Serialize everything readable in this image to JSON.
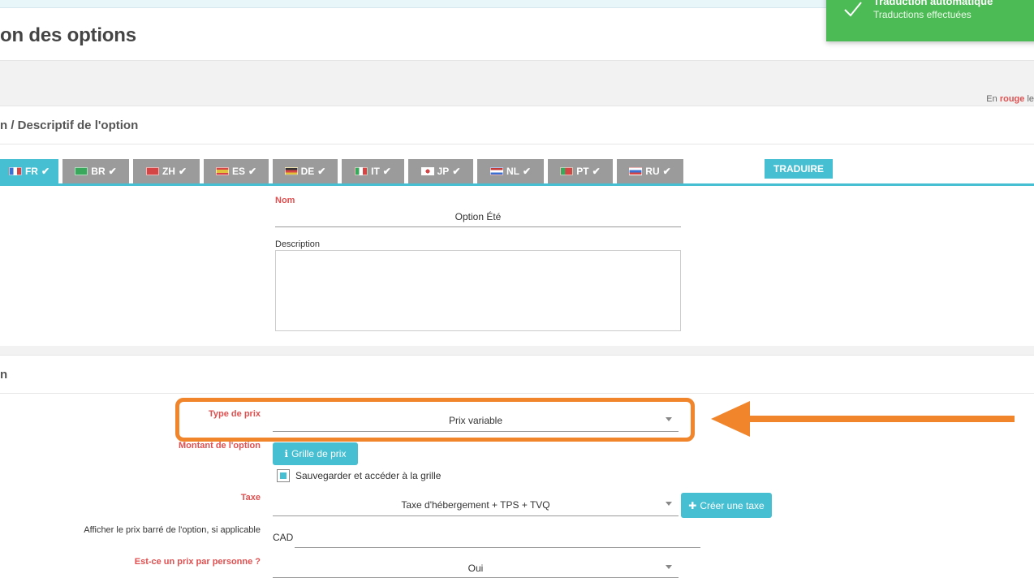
{
  "header": {
    "page_title": "on des options"
  },
  "toast": {
    "title": "Traduction automatique",
    "body": "Traductions effectuées"
  },
  "legend": {
    "prefix": "En",
    "red_word": "rouge",
    "suffix": "le"
  },
  "section_description": {
    "title": "n / Descriptif de l'option"
  },
  "language_tabs": [
    {
      "code": "FR",
      "flag_color": "#3b6fd1",
      "active": true
    },
    {
      "code": "BR",
      "flag_color": "#3aa85c"
    },
    {
      "code": "ZH",
      "flag_color": "#d64545"
    },
    {
      "code": "ES",
      "flag_color": "#e3a13b"
    },
    {
      "code": "DE",
      "flag_color": "#333333"
    },
    {
      "code": "IT",
      "flag_color": "#3aa85c"
    },
    {
      "code": "JP",
      "flag_color": "#ffffff"
    },
    {
      "code": "NL",
      "flag_color": "#c43b3b"
    },
    {
      "code": "PT",
      "flag_color": "#3aa85c"
    },
    {
      "code": "RU",
      "flag_color": "#3b6fd1"
    }
  ],
  "translate_button": "TRADUIRE",
  "form_description": {
    "name_label": "Nom",
    "name_value": "Option Été",
    "description_label": "Description",
    "description_value": ""
  },
  "section_price": {
    "title": "n"
  },
  "form_price": {
    "type_label": "Type de prix",
    "type_value": "Prix variable",
    "amount_label": "Montant de l'option",
    "grid_button": "Grille de prix",
    "save_grid_label": "Sauvegarder et accéder à la grille",
    "save_grid_checked": true,
    "tax_label": "Taxe",
    "tax_value": "Taxe d'hébergement + TPS + TVQ",
    "create_tax_button": "Créer une taxe",
    "strikethrough_label": "Afficher le prix barré de l'option, si applicable",
    "currency_value": "CAD",
    "per_person_label": "Est-ce un prix par personne ?",
    "per_person_value": "Oui"
  },
  "colors": {
    "accent": "#45bfd1",
    "required_label": "#e05050",
    "highlight": "#f0852b",
    "toast": "#4cba55"
  }
}
